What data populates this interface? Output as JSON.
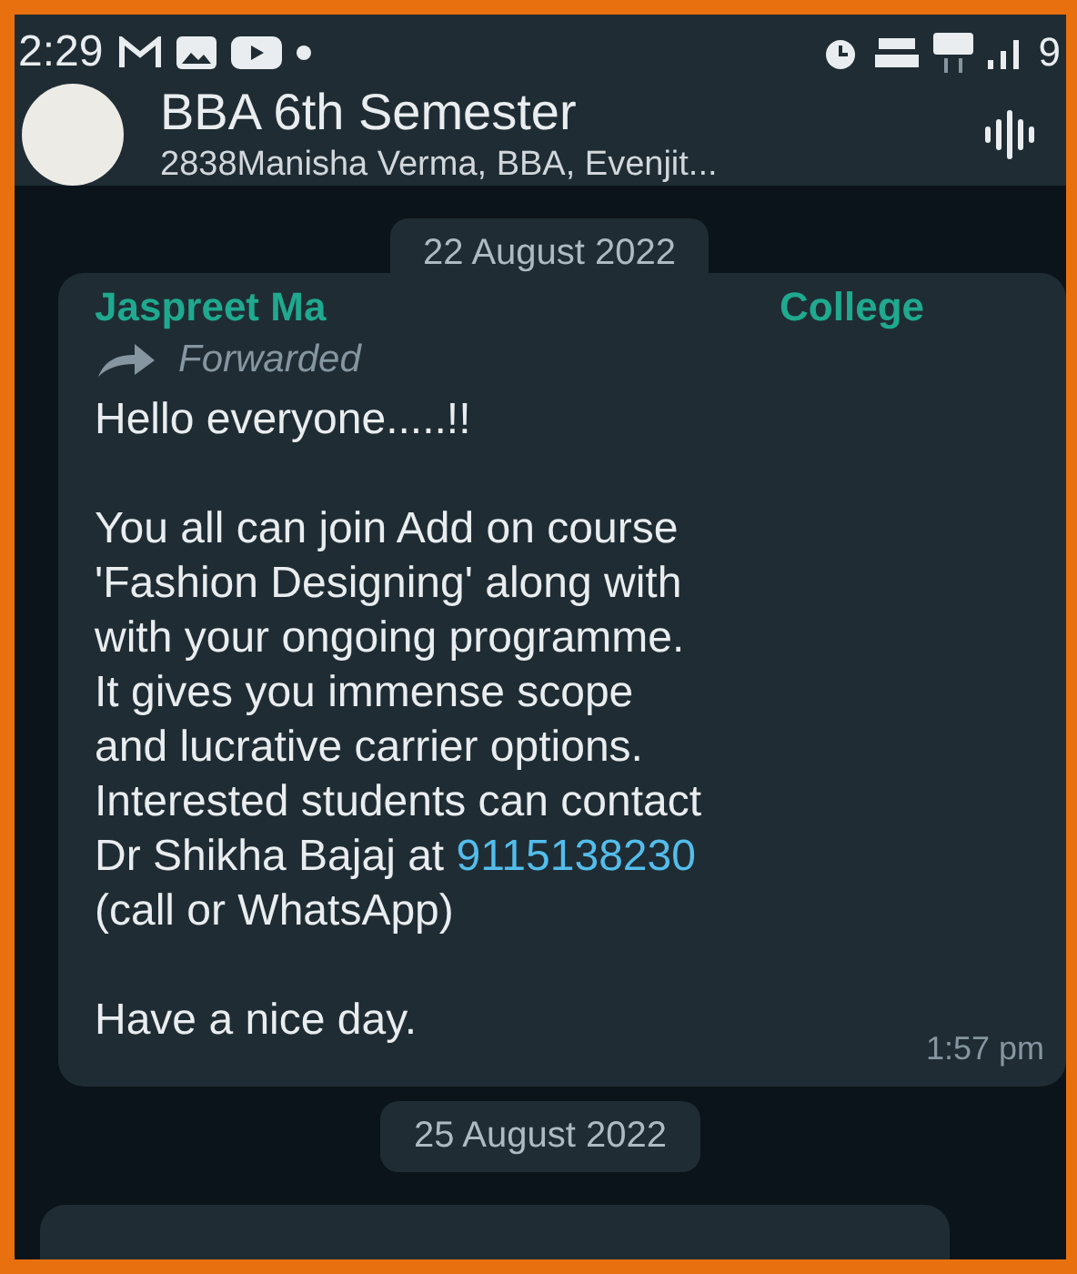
{
  "status_bar": {
    "time": "2:29",
    "battery_partial": "9"
  },
  "header": {
    "title": "BBA 6th Semester",
    "subtitle": "2838Manisha Verma, BBA, Evenjit..."
  },
  "chat": [
    {
      "kind": "date",
      "text": "22 August 2022"
    },
    {
      "kind": "message",
      "sender_start": "Jaspreet Ma",
      "sender_end": "College",
      "forwarded": true,
      "forwarded_label": "Forwarded",
      "paragraphs": [
        {
          "lines": [
            {
              "text": "Hello everyone.....!!"
            }
          ]
        },
        {
          "lines": [
            {
              "text": "You all can join Add on course"
            },
            {
              "text": "'Fashion Designing' along with"
            },
            {
              "text": "with your ongoing programme."
            },
            {
              "text": "It gives you immense scope"
            },
            {
              "text": "and lucrative carrier options."
            },
            {
              "text": "Interested students can contact"
            },
            {
              "text": "Dr Shikha Bajaj at ",
              "link": "9115138230"
            },
            {
              "text": "(call or WhatsApp)"
            }
          ]
        },
        {
          "lines": [
            {
              "text": "Have a nice day."
            }
          ]
        }
      ],
      "time": "1:57 pm"
    },
    {
      "kind": "date",
      "text": "25 August 2022"
    },
    {
      "kind": "partial_message"
    }
  ]
}
